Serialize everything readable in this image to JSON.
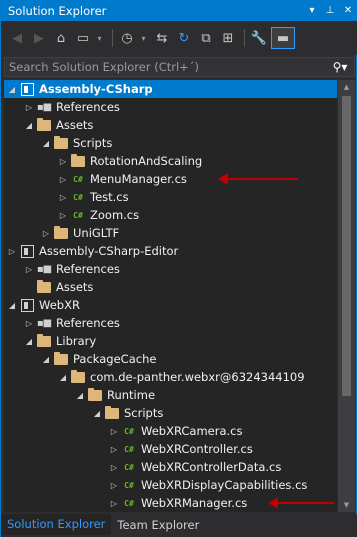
{
  "window": {
    "title": "Solution Explorer",
    "controls": {
      "dropdown": "▾",
      "pin": "⊥",
      "close": "✕"
    }
  },
  "toolbar": {
    "buttons": [
      "back-icon",
      "forward-icon",
      "home-icon",
      "sync-icon",
      "history-icon",
      "pending-changes-icon",
      "refresh-icon",
      "collapse-all-icon",
      "show-all-files-icon",
      "properties-icon",
      "preview-icon"
    ]
  },
  "search": {
    "placeholder": "Search Solution Explorer (Ctrl+´)"
  },
  "tree": [
    {
      "label": "Assembly-CSharp",
      "level": 0,
      "arrow": "open",
      "icon": "project-icon",
      "selected": true
    },
    {
      "label": "References",
      "level": 1,
      "arrow": "closed",
      "icon": "references-icon"
    },
    {
      "label": "Assets",
      "level": 1,
      "arrow": "open",
      "icon": "folder-icon"
    },
    {
      "label": "Scripts",
      "level": 2,
      "arrow": "open",
      "icon": "folder-icon"
    },
    {
      "label": "RotationAndScaling",
      "level": 3,
      "arrow": "closed",
      "icon": "folder-icon"
    },
    {
      "label": "MenuManager.cs",
      "level": 3,
      "arrow": "closed",
      "icon": "csharp-file-icon"
    },
    {
      "label": "Test.cs",
      "level": 3,
      "arrow": "closed",
      "icon": "csharp-file-icon"
    },
    {
      "label": "Zoom.cs",
      "level": 3,
      "arrow": "closed",
      "icon": "csharp-file-icon"
    },
    {
      "label": "UniGLTF",
      "level": 2,
      "arrow": "closed",
      "icon": "folder-icon"
    },
    {
      "label": "Assembly-CSharp-Editor",
      "level": 0,
      "arrow": "closed",
      "icon": "project-icon"
    },
    {
      "label": "References",
      "level": 1,
      "arrow": "closed",
      "icon": "references-icon"
    },
    {
      "label": "Assets",
      "level": 1,
      "arrow": "none",
      "icon": "folder-icon"
    },
    {
      "label": "WebXR",
      "level": 0,
      "arrow": "open",
      "icon": "project-icon"
    },
    {
      "label": "References",
      "level": 1,
      "arrow": "closed",
      "icon": "references-icon"
    },
    {
      "label": "Library",
      "level": 1,
      "arrow": "open",
      "icon": "folder-icon"
    },
    {
      "label": "PackageCache",
      "level": 2,
      "arrow": "open",
      "icon": "folder-icon"
    },
    {
      "label": "com.de-panther.webxr@6324344109",
      "level": 3,
      "arrow": "open",
      "icon": "folder-icon"
    },
    {
      "label": "Runtime",
      "level": 4,
      "arrow": "open",
      "icon": "folder-icon"
    },
    {
      "label": "Scripts",
      "level": 5,
      "arrow": "open",
      "icon": "folder-icon"
    },
    {
      "label": "WebXRCamera.cs",
      "level": 6,
      "arrow": "closed",
      "icon": "csharp-file-icon"
    },
    {
      "label": "WebXRController.cs",
      "level": 6,
      "arrow": "closed",
      "icon": "csharp-file-icon"
    },
    {
      "label": "WebXRControllerData.cs",
      "level": 6,
      "arrow": "closed",
      "icon": "csharp-file-icon"
    },
    {
      "label": "WebXRDisplayCapabilities.cs",
      "level": 6,
      "arrow": "closed",
      "icon": "csharp-file-icon"
    },
    {
      "label": "WebXRManager.cs",
      "level": 6,
      "arrow": "closed",
      "icon": "csharp-file-icon"
    }
  ],
  "annotations": [
    {
      "target": "MenuManager.cs",
      "color": "#c00000"
    },
    {
      "target": "WebXRManager.cs",
      "color": "#c00000"
    }
  ],
  "tabs": [
    {
      "label": "Solution Explorer",
      "active": true
    },
    {
      "label": "Team Explorer",
      "active": false
    }
  ],
  "colors": {
    "accent": "#007acc",
    "background": "#252526",
    "chrome": "#2d2d30",
    "folder": "#dcb67a",
    "csharp": "#68b723",
    "annotation": "#c00000"
  }
}
